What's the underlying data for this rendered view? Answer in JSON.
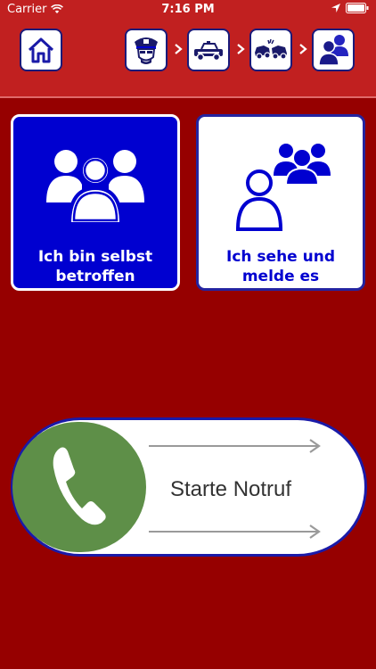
{
  "status_bar": {
    "carrier": "Carrier",
    "time": "7:16 PM"
  },
  "header": {
    "home_icon": "home-icon",
    "steps": [
      {
        "icon": "police-officer-icon"
      },
      {
        "icon": "police-car-icon"
      },
      {
        "icon": "car-crash-icon"
      },
      {
        "icon": "people-group-icon"
      }
    ]
  },
  "options": {
    "self": {
      "label": "Ich bin selbst betroffen",
      "icon": "group-person-icon"
    },
    "witness": {
      "label": "Ich sehe und melde es",
      "icon": "observer-group-icon"
    }
  },
  "slider": {
    "label": "Starte Notruf",
    "icon": "phone-icon"
  },
  "colors": {
    "header": "#c12020",
    "background": "#960000",
    "accent_blue": "#0000d0",
    "call_green": "#5e8f48"
  }
}
